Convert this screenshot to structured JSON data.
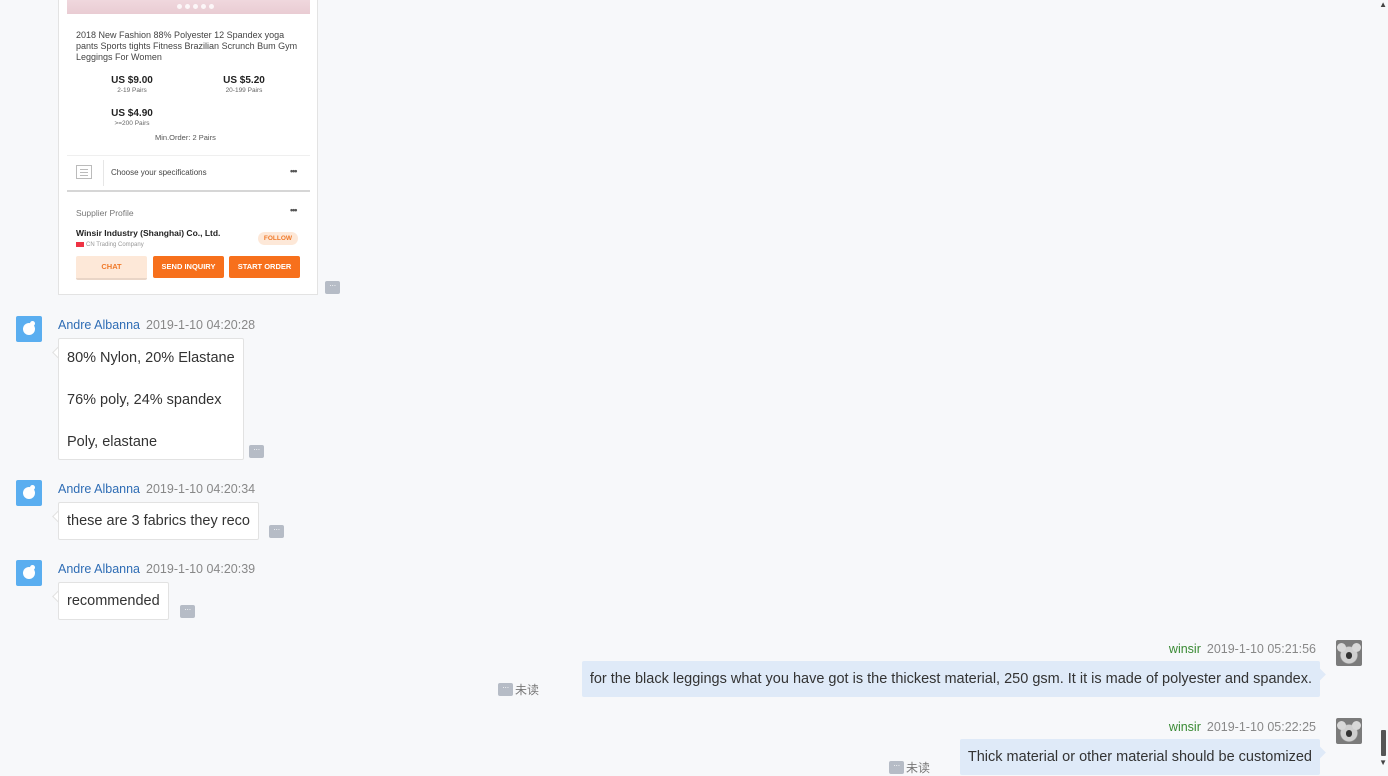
{
  "product_card": {
    "title": "2018 New Fashion 88% Polyester 12 Spandex  yoga pants Sports tights Fitness Brazilian Scrunch Bum Gym Leggings For Women",
    "prices": [
      {
        "price": "US $9.00",
        "range": "2-19 Pairs"
      },
      {
        "price": "US $5.20",
        "range": "20-199 Pairs"
      },
      {
        "price": "US $4.90",
        "range": ">=200 Pairs"
      }
    ],
    "min_order": "Min.Order: 2 Pairs",
    "spec_label": "Choose your specifications",
    "supplier_label": "Supplier Profile",
    "supplier_name": "Winsir Industry (Shanghai) Co., Ltd.",
    "supplier_type": "CN  Trading Company",
    "follow_label": "FOLLOW",
    "chat_label": "CHAT",
    "inquiry_label": "SEND INQUIRY",
    "order_label": "START ORDER",
    "more_glyph": "•••"
  },
  "messages": [
    {
      "sender": "Andre Albanna",
      "time": "2019-1-10 04:20:28",
      "lines": [
        "80% Nylon, 20% Elastane",
        "76% poly, 24% spandex",
        "Poly, elastane"
      ]
    },
    {
      "sender": "Andre Albanna",
      "time": "2019-1-10 04:20:34",
      "text": "these are 3 fabrics they reco"
    },
    {
      "sender": "Andre Albanna",
      "time": "2019-1-10 04:20:39",
      "text": "recommended"
    },
    {
      "sender": "winsir",
      "time": "2019-1-10 05:21:56",
      "text": "for the black leggings what you have got is the thickest material, 250 gsm. It it is made of polyester and spandex.",
      "status": "未读"
    },
    {
      "sender": "winsir",
      "time": "2019-1-10 05:22:25",
      "text": "Thick material or other material should be customized",
      "status": "未读"
    }
  ],
  "more_button": "···",
  "scrollbar": {
    "up": "▲",
    "down": "▼"
  },
  "colors": {
    "accent_orange": "#f7701c",
    "sender_left": "#2f6db5",
    "sender_right": "#3a8a34",
    "own_bubble": "#dfeaf8"
  }
}
